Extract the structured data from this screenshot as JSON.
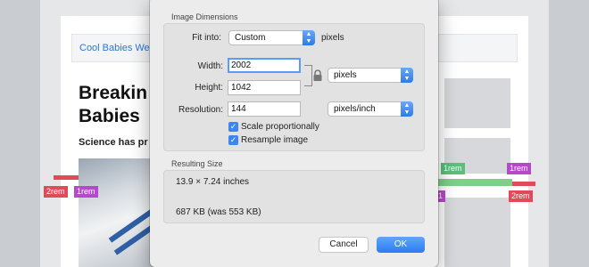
{
  "background": {
    "nav_text": "Cool Babies We",
    "headline_line1": "Breakin",
    "headline_line2": "Babies",
    "subtitle": "Science has pr",
    "tags": {
      "left_red": "2rem",
      "left_purple": "1rem",
      "right_green": "1rem",
      "right_purple_top": "1rem",
      "right_purple_bottom": "1",
      "right_red": "2rem"
    }
  },
  "dialog": {
    "image_dimensions_title": "Image Dimensions",
    "fit_into": {
      "label": "Fit into:",
      "value": "Custom",
      "unit": "pixels"
    },
    "width": {
      "label": "Width:",
      "value": "2002"
    },
    "height": {
      "label": "Height:",
      "value": "1042"
    },
    "dimension_unit": "pixels",
    "resolution": {
      "label": "Resolution:",
      "value": "144",
      "unit": "pixels/inch"
    },
    "scale_proportionally": {
      "label": "Scale proportionally",
      "checked": true
    },
    "resample_image": {
      "label": "Resample image",
      "checked": true
    },
    "resulting_size_title": "Resulting Size",
    "resulting_dimensions": "13.9 × 7.24 inches",
    "resulting_filesize": "687 KB (was 553 KB)",
    "cancel_label": "Cancel",
    "ok_label": "OK"
  },
  "icons": {
    "popup_arrows": "popup-arrows-icon",
    "checkmark": "checkmark-icon",
    "lock": "lock-icon"
  },
  "colors": {
    "accent": "#3b86f0",
    "link": "#2b77d6",
    "tag_red": "#e04a59",
    "tag_purple": "#b54ac9",
    "tag_green": "#5cbf7b"
  }
}
